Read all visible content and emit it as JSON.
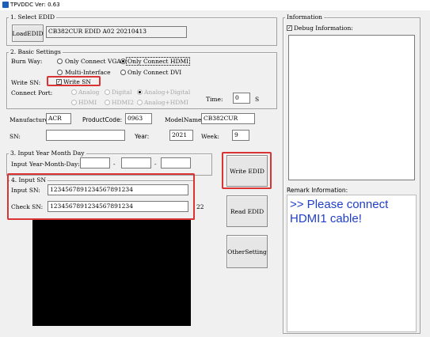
{
  "window": {
    "title": "TPVDDC  Ver: 0.63"
  },
  "select_edid": {
    "legend": "1. Select EDID",
    "load_button": "LoadEDID",
    "edid_name": "CB382CUR EDID A02 20210413"
  },
  "basic_settings": {
    "legend": "2. Basic Settings",
    "burn_way_label": "Burn Way:",
    "burn_options": [
      {
        "label": "Only Connect VGA",
        "selected": false
      },
      {
        "label": "Only Connect HDMI",
        "selected": true
      },
      {
        "label": "Multi-Interface",
        "selected": false
      },
      {
        "label": "Only Connect DVI",
        "selected": false
      }
    ],
    "write_sn_label": "Write SN:",
    "write_sn_checkbox": "Write SN",
    "connect_port_label": "Connect Port:",
    "port_options": [
      "Analog",
      "Digital",
      "Analog+Digital",
      "HDMI",
      "HDMI2",
      "Analog+HDMI"
    ],
    "time_label": "Time:",
    "time_value": "0",
    "time_unit": "S"
  },
  "monitor_info": {
    "manufacture_label": "Manufacture:",
    "manufacture_value": "ACR",
    "product_code_label": "ProductCode:",
    "product_code_value": "0963",
    "model_name_label": "ModelName:",
    "model_name_value": "CB382CUR",
    "sn_label": "SN:",
    "sn_value": "",
    "year_label": "Year:",
    "year_value": "2021",
    "week_label": "Week:",
    "week_value": "9"
  },
  "input_ymd": {
    "legend": "3. Input Year Month Day",
    "label": "Input Year-Month-Day:",
    "sep": "-"
  },
  "input_sn": {
    "legend": "4. Input SN",
    "input_label": "Input SN:",
    "input_value": "1234567891234567891234",
    "check_label": "Check SN:",
    "check_value": "1234567891234567891234",
    "partial_text": "22"
  },
  "buttons": {
    "write_edid": "Write EDID",
    "read_edid": "Read EDID",
    "other_setting": "OtherSetting"
  },
  "information": {
    "legend": "Information",
    "debug_label": "Debug Information:",
    "debug_checked": true,
    "remark_label": "Remark Information:",
    "remark_text": ">> Please connect HDMI1 cable!"
  },
  "colors": {
    "highlight": "#d93333",
    "remark_text": "#1f3ec9",
    "titlebar_icon": "#1c5fb8"
  }
}
